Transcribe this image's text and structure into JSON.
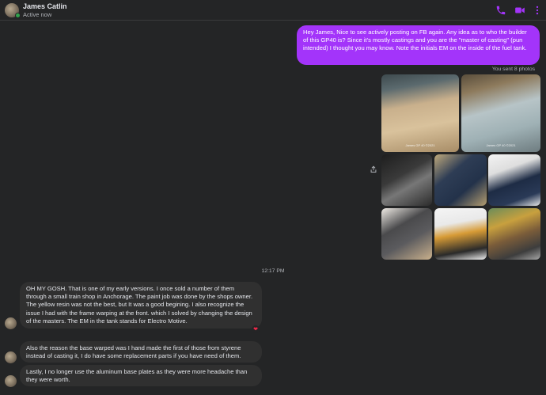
{
  "header": {
    "contact_name": "James Catlin",
    "status": "Active now",
    "accent_color": "#a334fa"
  },
  "conversation": {
    "outgoing_message": "Hey James, Nice to see actively posting on FB again.  Any idea as to who the builder of this GP40 is?  Since it's mostly castings and you are the \"master of casting\" (pun intended) I thought you may know.  Note the initials EM on the inside of the fuel tank.",
    "sent_note": "You sent 8 photos",
    "timestamp": "12:17 PM",
    "incoming_messages": [
      {
        "text": "OH MY GOSH. That is one of my early versions. I once sold a number of them through a small train shop in Anchorage. The paint job was done by the shops owner. The yellow resin was not the best, but It was a good begining. I also recognize the issue I had with the frame warping at the front. which I solved by changing the design of the masters. The EM in the tank stands for Electro Motive."
      },
      {
        "text": "Also the reason the base warped was I hand made the first of those from styrene instead of casting it, I do have some replacement parts if you have need of them."
      },
      {
        "text": "Lastly, I no longer use the aluminum base plates as they were more headache than they were worth."
      }
    ],
    "reaction": "heart",
    "photos": [
      {
        "caption": "James GP 40\n©2021"
      },
      {
        "caption": "James GP 40\n©2021"
      },
      {
        "caption": ""
      },
      {
        "caption": ""
      },
      {
        "caption": ""
      },
      {
        "caption": ""
      },
      {
        "caption": ""
      },
      {
        "caption": ""
      }
    ]
  },
  "icons": [
    "phone-icon",
    "video-icon",
    "more-icon",
    "share-icon",
    "heart-reaction-icon"
  ]
}
